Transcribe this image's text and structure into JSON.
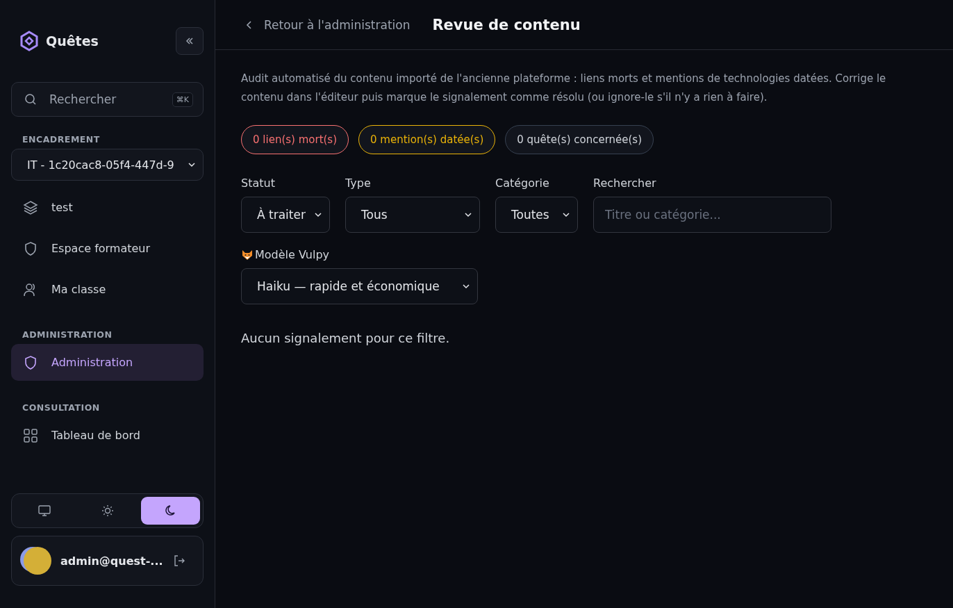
{
  "sidebar": {
    "brand": "Quêtes",
    "search": {
      "placeholder": "Rechercher",
      "shortcut": "⌘K"
    },
    "sections": [
      {
        "title": "ENCADREMENT",
        "select": "IT - 1c20cac8-05f4-447d-9",
        "items": [
          {
            "label": "test",
            "kind": "layers",
            "selected": false
          },
          {
            "label": "Espace formateur",
            "kind": "shield",
            "selected": false
          },
          {
            "label": "Ma classe",
            "kind": "users",
            "selected": false
          }
        ]
      },
      {
        "title": "ADMINISTRATION",
        "items": [
          {
            "label": "Administration",
            "kind": "shield",
            "selected": true
          }
        ]
      },
      {
        "title": "CONSULTATION",
        "items": [
          {
            "label": "Tableau de bord",
            "kind": "grid",
            "selected": false
          }
        ]
      }
    ],
    "theme": [
      {
        "kind": "system",
        "selected": false
      },
      {
        "kind": "light",
        "selected": false
      },
      {
        "kind": "dark",
        "selected": true
      }
    ],
    "user": {
      "email": "admin@quest-..."
    }
  },
  "header": {
    "back": "Retour à l'administration",
    "title": "Revue de contenu"
  },
  "description": "Audit automatisé du contenu importé de l'ancienne plateforme : liens morts et mentions de technologies datées. Corrige le contenu dans l'éditeur puis marque le signalement comme résolu (ou ignore-le s'il n'y a rien à faire).",
  "badges": [
    {
      "label": "0 lien(s) mort(s)",
      "color": "#f87171"
    },
    {
      "label": "0 mention(s) datée(s)",
      "color": "#eab308"
    },
    {
      "label": "0 quête(s) concernée(s)",
      "color": "#d1d5db"
    }
  ],
  "filters": [
    {
      "kind": "select",
      "label": "Statut",
      "value": "À traiter"
    },
    {
      "kind": "select",
      "label": "Type",
      "value": "Tous"
    },
    {
      "kind": "select",
      "label": "Catégorie",
      "value": "Toutes"
    },
    {
      "kind": "search",
      "label": "Rechercher",
      "placeholder": "Titre ou catégorie..."
    }
  ],
  "model": {
    "label": "Modèle Vulpy",
    "value": "Haiku — rapide et économique"
  },
  "empty": "Aucun signalement pour ce filtre."
}
